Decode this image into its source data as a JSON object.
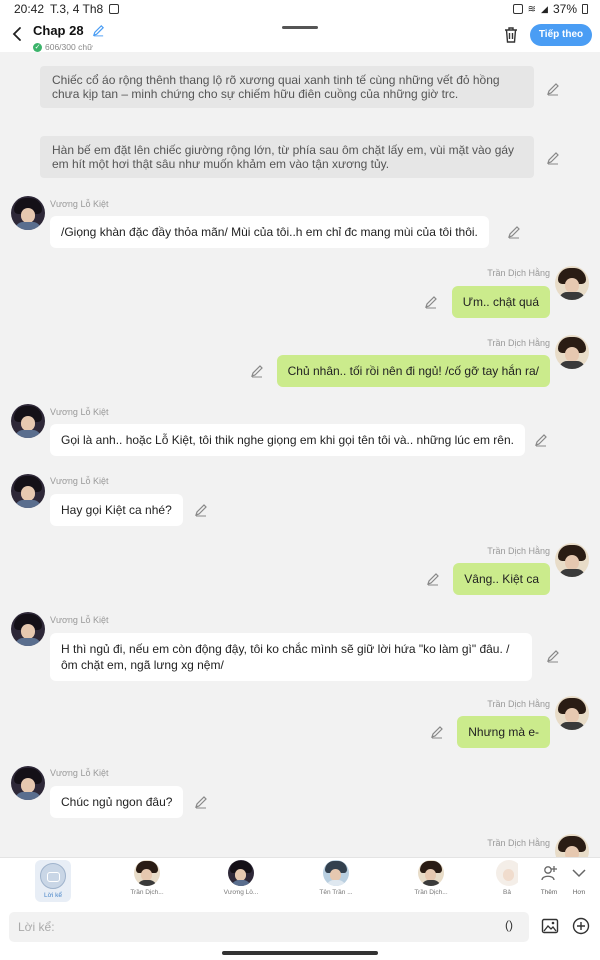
{
  "status_bar": {
    "time": "20:42",
    "date": "T.3, 4 Th8",
    "battery": "37%"
  },
  "header": {
    "title": "Chap 28",
    "word_count": "606/300 chữ",
    "next_label": "Tiếp theo"
  },
  "messages": [
    {
      "type": "narration",
      "text": "Chiếc cổ áo rộng thênh thang lộ rõ xương quai xanh tinh tế cùng những vết đỏ hồng chưa kịp tan – minh chứng cho sự chiếm hữu điên cuồng của những giờ trc."
    },
    {
      "type": "narration",
      "text": "Hàn bế em đặt lên chiếc giường rộng lớn, từ phía sau ôm chặt lấy em, vùi mặt vào gáy em hít một hơi thật sâu như muốn khảm em vào tận xương tủy."
    },
    {
      "type": "in",
      "sender": "Vương Lỗ Kiệt",
      "text": "/Giọng khàn đặc đầy thỏa mãn/ Mùi của tôi..h em chỉ đc mang mùi của tôi thôi."
    },
    {
      "type": "out",
      "sender": "Trần Dịch Hằng",
      "text": "Ưm.. chật quá"
    },
    {
      "type": "out",
      "sender": "Trần Dịch Hằng",
      "text": "Chủ nhân.. tối rồi nên đi ngủ! /cố gỡ tay hắn ra/"
    },
    {
      "type": "in",
      "sender": "Vương Lỗ Kiệt",
      "text": "Gọi là anh.. hoặc Lỗ Kiệt, tôi thik nghe giọng em khi gọi tên tôi và.. những lúc em rên."
    },
    {
      "type": "in",
      "sender": "Vương Lỗ Kiệt",
      "text": "Hay gọi Kiệt ca nhé?"
    },
    {
      "type": "out",
      "sender": "Trần Dịch Hằng",
      "text": "Vâng.. Kiệt ca"
    },
    {
      "type": "in",
      "sender": "Vương Lỗ Kiệt",
      "text": "H thì ngủ đi, nếu em còn động đậy, tôi ko chắc mình sẽ giữ lời hứa \"ko làm gì\" đâu. /ôm chặt em, ngã lưng xg nệm/"
    },
    {
      "type": "out",
      "sender": "Trần Dịch Hằng",
      "text": "Nhưng mà e-"
    },
    {
      "type": "in",
      "sender": "Vương Lỗ Kiệt",
      "text": "Chúc ngủ ngon đâu?"
    },
    {
      "type": "out",
      "sender": "Trần Dịch Hằng",
      "text": ""
    }
  ],
  "character_bar": {
    "narrator_label": "Lời kể",
    "characters": [
      "Trần Dịch...",
      "Vương Lỗ...",
      "Tên Trần ...",
      "Trần Dịch..."
    ],
    "partial_label": "Bả",
    "more_label": "Thêm",
    "collapse_label": "Hơn"
  },
  "input": {
    "placeholder": "Lời kể:",
    "paren_label": "()"
  },
  "colors": {
    "accent": "#4a9df4",
    "outgoing_bubble": "#cbeb8c",
    "narration_bg": "#e6e6e6"
  },
  "icons": [
    "back-arrow-icon",
    "pencil-icon",
    "check-icon",
    "trash-icon",
    "image-icon",
    "add-circle-icon",
    "chevron-down-icon",
    "add-person-icon"
  ]
}
